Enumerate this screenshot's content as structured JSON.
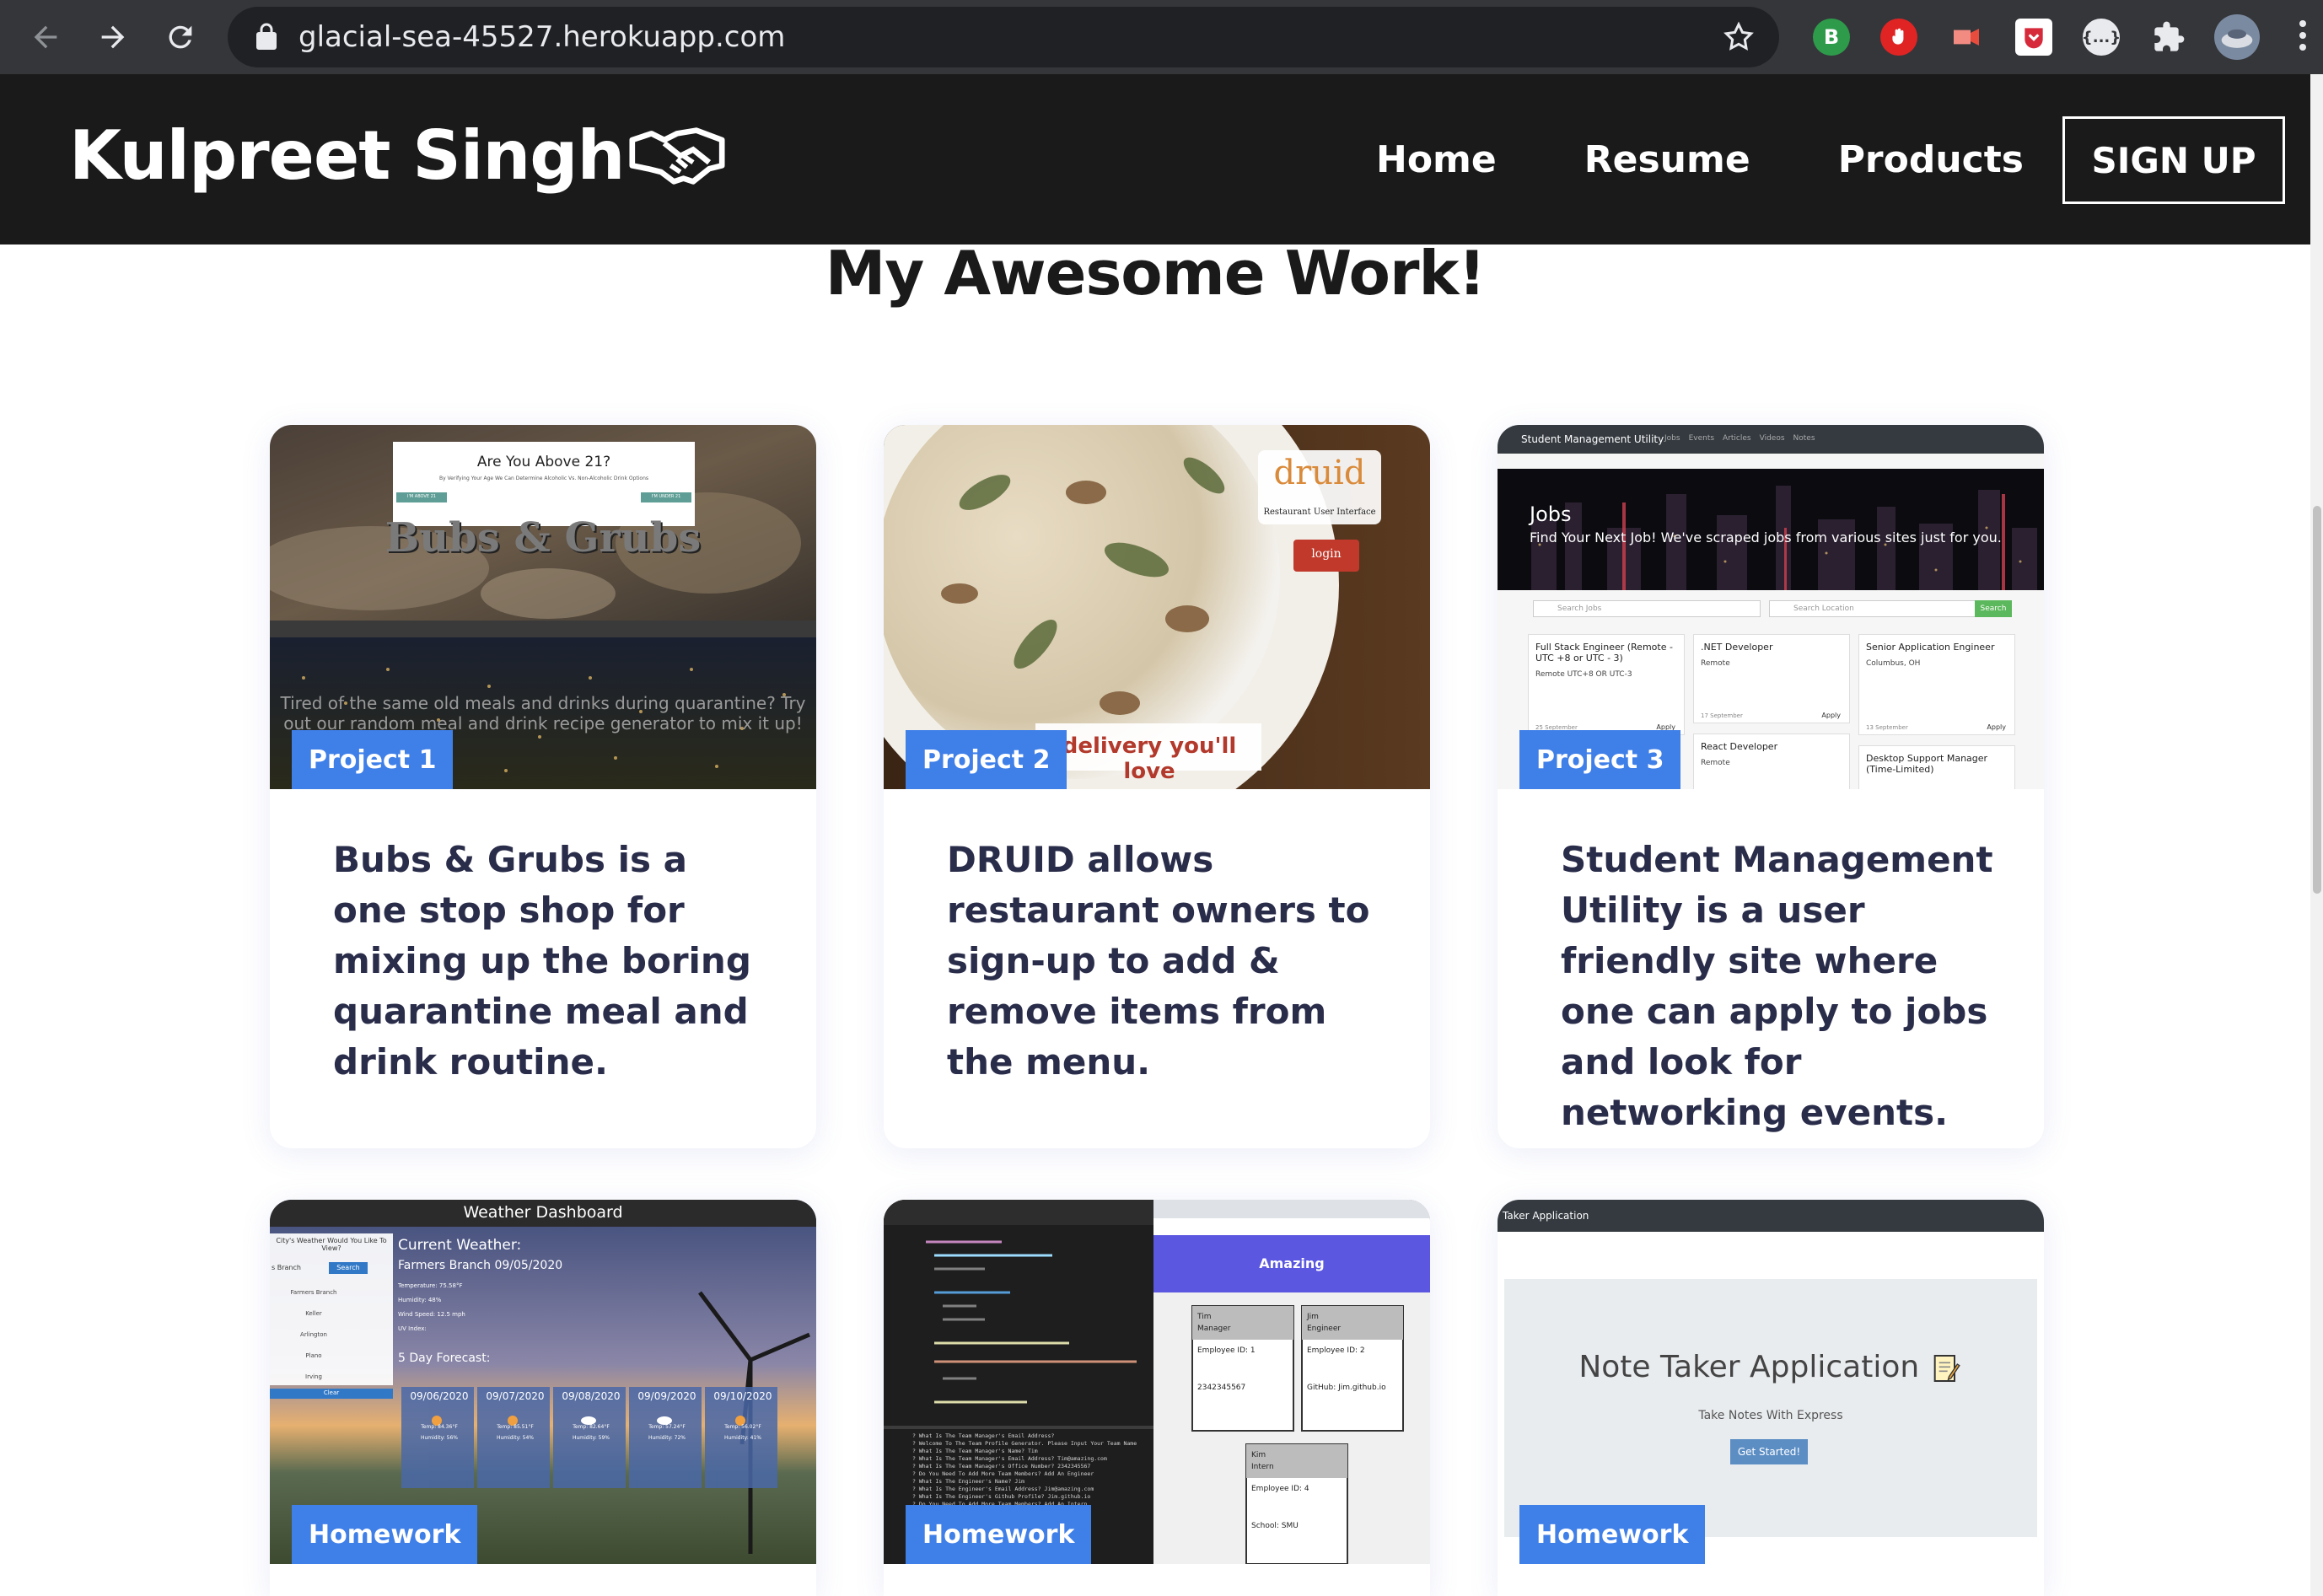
{
  "browser": {
    "url": "glacial-sea-45527.herokuapp.com",
    "extensions": [
      {
        "name": "b-extension-icon",
        "label": "B",
        "color": "#2e9b4b"
      },
      {
        "name": "hand-stop-extension-icon",
        "label": "",
        "color": "#e02424"
      },
      {
        "name": "video-extension-icon",
        "label": "",
        "color": "#e74c3c"
      },
      {
        "name": "pocket-extension-icon",
        "label": "",
        "color": "#d6293a"
      },
      {
        "name": "json-extension-icon",
        "label": "{...}",
        "color": "#e8eaed"
      },
      {
        "name": "puzzle-extensions-icon",
        "label": "",
        "color": "#e8eaed"
      },
      {
        "name": "profile-avatar",
        "label": "",
        "color": "#7a8aa0"
      }
    ]
  },
  "navbar": {
    "brand": "Kulpreet Singh",
    "links": [
      "Home",
      "Resume",
      "Products"
    ],
    "signup": "SIGN UP"
  },
  "section": {
    "title": "My Awesome Work!"
  },
  "cards": [
    {
      "tag": "Project 1",
      "text": "Bubs & Grubs is a one stop shop for mixing up the boring quarantine meal and drink routine.",
      "thumb": {
        "modal_title": "Are You Above 21?",
        "modal_sub": "By Verifying Your Age We Can Determine Alcoholic Vs. Non-Alcoholic Drink Options",
        "btn_above": "I'M ABOVE 21",
        "btn_under": "I'M UNDER 21",
        "hero": "Bubs & Grubs",
        "tagline1": "Tired of the same old meals and drinks during quarantine? Try",
        "tagline2": "out our random meal and drink recipe generator to mix it up!"
      }
    },
    {
      "tag": "Project 2",
      "text": "DRUID allows restaurant owners to sign-up to add & remove items from the menu.",
      "thumb": {
        "logo": "druid",
        "logo_sub": "Restaurant User Interface",
        "login": "login",
        "banner": "delivery you'll love"
      }
    },
    {
      "tag": "Project 3",
      "text": "Student Management Utility is a user friendly site where one can apply to jobs and look for networking events.",
      "thumb": {
        "app_title": "Student Management Utility",
        "app_nav": [
          "Jobs",
          "Events",
          "Articles",
          "Videos",
          "Notes"
        ],
        "hero_title": "Jobs",
        "hero_sub": "Find Your Next Job! We've scraped jobs from various sites just for you.",
        "search_jobs": "Search Jobs",
        "search_location": "Search Location",
        "search_btn": "Search",
        "jobs": [
          {
            "title": "Full Stack Engineer (Remote - UTC +8 or UTC - 3)",
            "loc": "Remote UTC+8 OR UTC-3",
            "date": "25 September",
            "apply": "Apply"
          },
          {
            "title": ".NET Developer",
            "loc": "Remote",
            "date": "17 September",
            "apply": "Apply"
          },
          {
            "title": "Senior Application Engineer",
            "loc": "Columbus, OH",
            "date": "13 September",
            "apply": "Apply"
          },
          {
            "title": "React Developer",
            "loc": "Remote",
            "date": "",
            "apply": ""
          },
          {
            "title": "Desktop Support Manager (Time-Limited)",
            "loc": "",
            "date": "",
            "apply": ""
          }
        ]
      }
    },
    {
      "tag": "Homework",
      "thumb": {
        "title": "Weather Dashboard",
        "side_prompt": "City's Weather Would You Like To View?",
        "side_input": "s Branch",
        "side_btn": "Search",
        "cities": [
          "Farmers Branch",
          "Keller",
          "Arlington",
          "Plano",
          "Irving"
        ],
        "clear": "Clear",
        "current_label": "Current Weather:",
        "current_city": "Farmers Branch 09/05/2020",
        "stats": [
          "Temperature: 75.58°F",
          "Humidity: 48%",
          "Wind Speed: 12.5 mph",
          "UV Index:"
        ],
        "forecast_label": "5 Day Forecast:",
        "forecast": [
          {
            "date": "09/06/2020",
            "temp": "Temp: 84.36°F",
            "hum": "Humidity: 56%"
          },
          {
            "date": "09/07/2020",
            "temp": "Temp: 85.51°F",
            "hum": "Humidity: 54%"
          },
          {
            "date": "09/08/2020",
            "temp": "Temp: 82.64°F",
            "hum": "Humidity: 59%"
          },
          {
            "date": "09/09/2020",
            "temp": "Temp: 57.24°F",
            "hum": "Humidity: 72%"
          },
          {
            "date": "09/10/2020",
            "temp": "Temp: 56.02°F",
            "hum": "Humidity: 41%"
          }
        ]
      }
    },
    {
      "tag": "Homework",
      "thumb": {
        "banner": "Amazing",
        "people": [
          {
            "name": "Tim",
            "role": "Manager",
            "id": "Employee ID: 1",
            "extra": "2342345567"
          },
          {
            "name": "Jim",
            "role": "Engineer",
            "id": "Employee ID: 2",
            "extra": "GitHub: Jim.github.io"
          },
          {
            "name": "Kim",
            "role": "Intern",
            "id": "Employee ID: 4",
            "extra": "School: SMU"
          }
        ],
        "terminal_lines": [
          "? What Is The Team Manager's Email Address?",
          "? Welcome To The Team Profile Generator. Please Input Your Team Name",
          "? What Is The Team Manager's Name? Tim",
          "? What Is The Team Manager's Email Address? Tim@amazing.com",
          "? What Is The Team Manager's Office Number? 2342345567",
          "? Do You Need To Add More Team Members? Add An Engineer",
          "? What Is The Engineer's Name? Jim",
          "? What Is The Engineer's Email Address? Jim@amazing.com",
          "? What Is The Engineer's Github Profile? Jim.github.io",
          "? Do You Need To Add More Team Members? Add An Intern"
        ]
      }
    },
    {
      "tag": "Homework",
      "thumb": {
        "bar": "Taker Application",
        "title": "Note Taker Application",
        "sub": "Take Notes With Express",
        "btn": "Get Started!"
      }
    }
  ]
}
